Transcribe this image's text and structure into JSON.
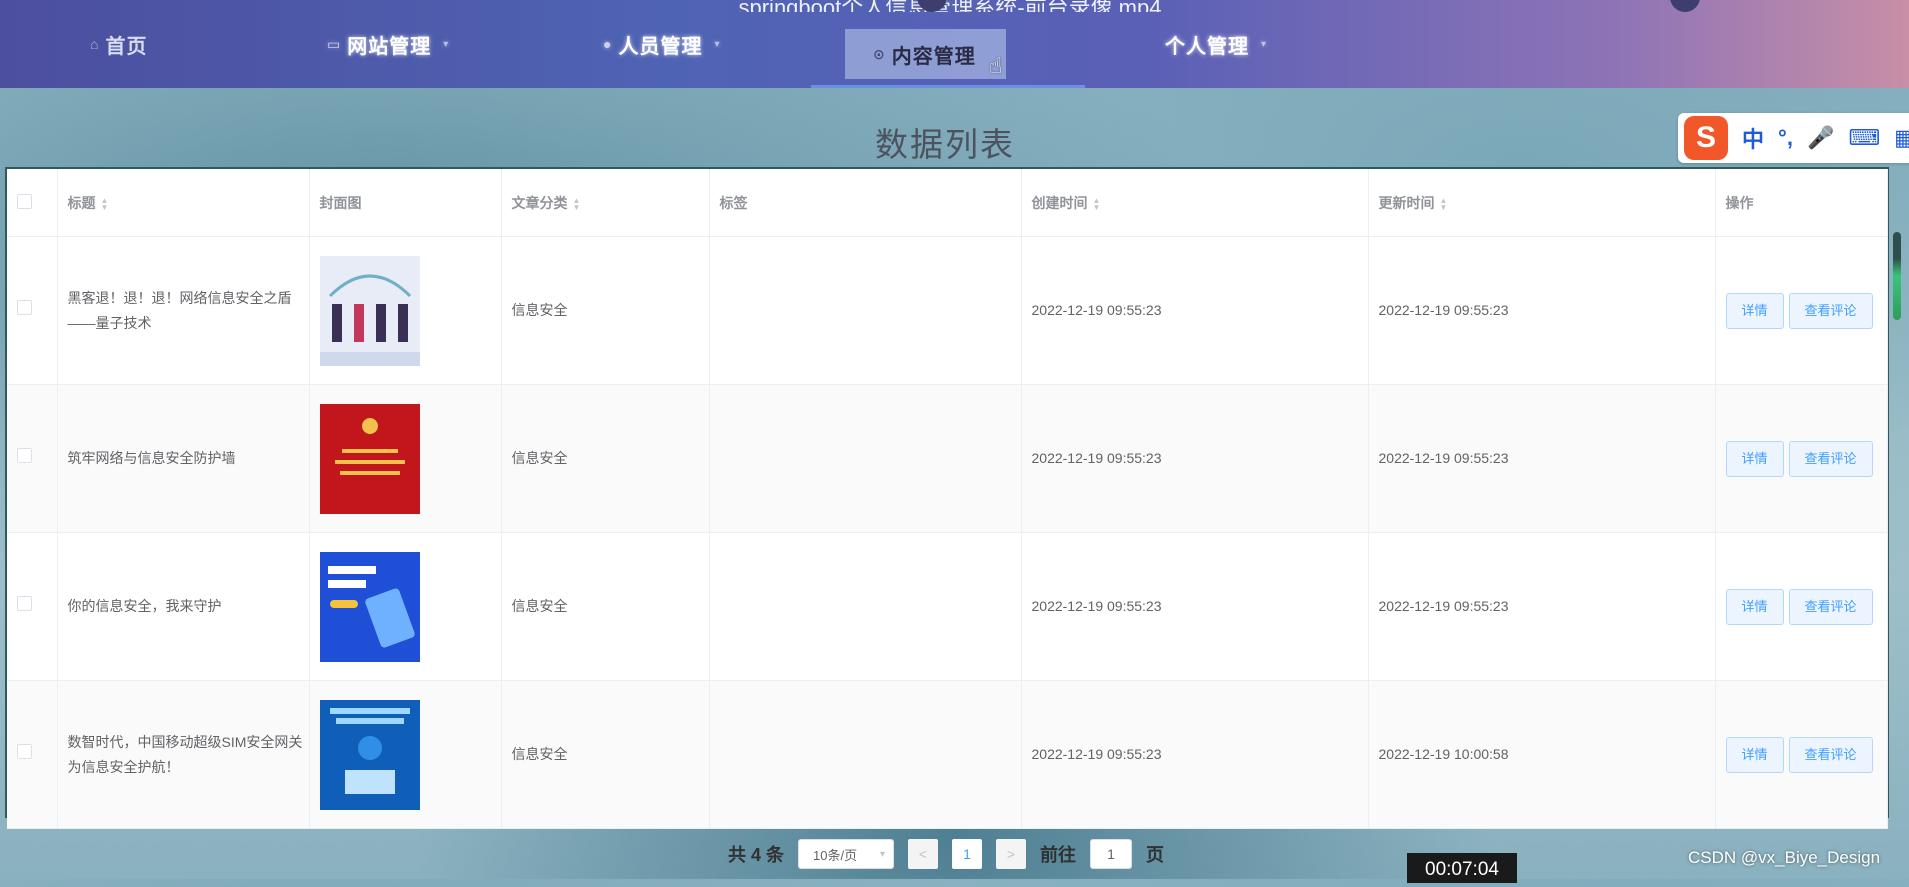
{
  "window": {
    "title": "springboot个人信息管理系统-前台录像.mp4"
  },
  "nav": {
    "items": [
      {
        "label": "首页",
        "icon": "home-icon"
      },
      {
        "label": "网站管理",
        "icon": "monitor-icon"
      },
      {
        "label": "人员管理",
        "icon": "user-icon"
      },
      {
        "label": "内容管理",
        "icon": "settings-icon"
      },
      {
        "label": "个人管理",
        "icon": ""
      }
    ],
    "active": "内容管理"
  },
  "page_title": "数据列表",
  "ime": {
    "logo": "S",
    "lang": "中",
    "punct": "°,",
    "mic": "🎤",
    "keyboard": "⌨",
    "menu": "▦"
  },
  "table": {
    "headers": [
      "标题",
      "封面图",
      "文章分类",
      "标签",
      "创建时间",
      "更新时间",
      "操作"
    ],
    "rows": [
      {
        "title": "黑客退！退！退！网络信息安全之盾——量子技术",
        "category": "信息安全",
        "tag": "",
        "created": "2022-12-19 09:55:23",
        "updated": "2022-12-19 09:55:23"
      },
      {
        "title": "筑牢网络与信息安全防护墙",
        "category": "信息安全",
        "tag": "",
        "created": "2022-12-19 09:55:23",
        "updated": "2022-12-19 09:55:23"
      },
      {
        "title": "你的信息安全，我来守护",
        "category": "信息安全",
        "tag": "",
        "created": "2022-12-19 09:55:23",
        "updated": "2022-12-19 09:55:23"
      },
      {
        "title": "数智时代，中国移动超级SIM安全网关为信息安全护航！",
        "category": "信息安全",
        "tag": "",
        "created": "2022-12-19 09:55:23",
        "updated": "2022-12-19 10:00:58"
      }
    ],
    "actions": {
      "detail": "详情",
      "comments": "查看评论"
    }
  },
  "pagination": {
    "total": "共 4 条",
    "page_size": "10条/页",
    "prev": "<",
    "current_page": "1",
    "next": ">",
    "goto_label": "前往",
    "goto_value": "1",
    "page_suffix": "页"
  },
  "overlay": {
    "timer": "00:07:04",
    "watermark": "CSDN @vx_Biye_Design"
  }
}
